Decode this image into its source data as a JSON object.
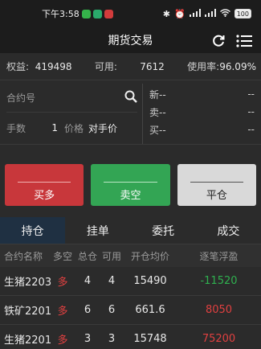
{
  "status_bar": {
    "time": "下午3:58",
    "battery": "100"
  },
  "header": {
    "title": "期货交易"
  },
  "account": {
    "equity_label": "权益:",
    "equity_value": "419498",
    "available_label": "可用:",
    "available_value": "7612",
    "usage_label": "使用率:",
    "usage_value": "96.09%"
  },
  "order": {
    "contract_placeholder": "合约号",
    "qty_label": "手数",
    "qty_value": "1",
    "price_label": "价格",
    "price_type": "对手价"
  },
  "quote": [
    {
      "label": "新",
      "left": "--",
      "right": "--"
    },
    {
      "label": "卖",
      "left": "--",
      "right": "--"
    },
    {
      "label": "买",
      "left": "--",
      "right": "--"
    }
  ],
  "buttons": {
    "buy": "买多",
    "sell": "卖空",
    "close": "平仓"
  },
  "tabs": [
    "持仓",
    "挂单",
    "委托",
    "成交"
  ],
  "table": {
    "headers": [
      "合约名称",
      "多空",
      "总仓",
      "可用",
      "开仓均价",
      "逐笔浮盈"
    ],
    "rows": [
      {
        "name": "生猪2203",
        "dir": "多",
        "total": "4",
        "avail": "4",
        "price": "15490",
        "pnl": "-11520"
      },
      {
        "name": "铁矿2201",
        "dir": "多",
        "total": "6",
        "avail": "6",
        "price": "661.6",
        "pnl": "8050"
      },
      {
        "name": "生猪2201",
        "dir": "多",
        "total": "3",
        "avail": "3",
        "price": "15748",
        "pnl": "75200"
      }
    ]
  },
  "colors": {
    "buy": "#c8373b",
    "sell": "#33a554",
    "active_tab": "#1f3042",
    "profit": "#e04040",
    "loss": "#2fb14f"
  },
  "icons": {
    "header_left": "refresh-icon",
    "header_right": "menu-icon",
    "search": "search-icon"
  }
}
